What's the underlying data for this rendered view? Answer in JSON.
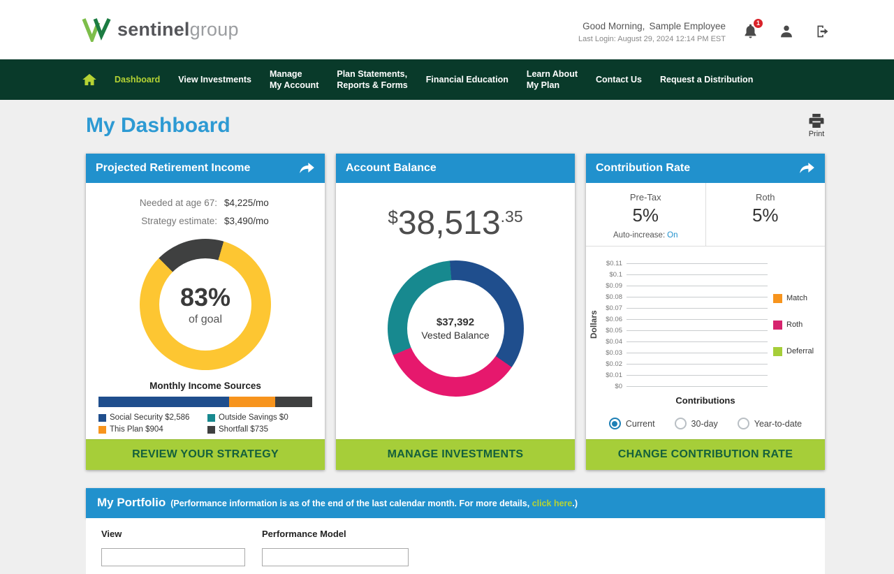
{
  "header": {
    "logo_primary": "sentinel",
    "logo_secondary": "group",
    "greeting": "Good Morning,",
    "user_name": "Sample Employee",
    "last_login": "Last Login: August 29, 2024 12:14 PM EST",
    "notification_badge": "1"
  },
  "nav": {
    "items": [
      {
        "lines": [
          "Dashboard"
        ],
        "active": true
      },
      {
        "lines": [
          "View Investments"
        ]
      },
      {
        "lines": [
          "Manage",
          "My Account"
        ]
      },
      {
        "lines": [
          "Plan Statements,",
          "Reports & Forms"
        ]
      },
      {
        "lines": [
          "Financial Education"
        ]
      },
      {
        "lines": [
          "Learn About",
          "My Plan"
        ]
      },
      {
        "lines": [
          "Contact Us"
        ]
      },
      {
        "lines": [
          "Request a Distribution"
        ]
      }
    ]
  },
  "page": {
    "title": "My Dashboard",
    "print_label": "Print"
  },
  "retirement_card": {
    "title": "Projected Retirement Income",
    "rows": [
      {
        "label": "Needed at age 67:",
        "value": "$4,225/mo"
      },
      {
        "label": "Strategy estimate:",
        "value": "$3,490/mo"
      }
    ],
    "donut_percent": "83%",
    "donut_caption": "of goal",
    "sources_title": "Monthly Income Sources",
    "legend": [
      {
        "label": "Social Security $2,586",
        "color": "#1f4e8d"
      },
      {
        "label": "Outside Savings $0",
        "color": "#17898f"
      },
      {
        "label": "This Plan $904",
        "color": "#f7941d"
      },
      {
        "label": "Shortfall $735",
        "color": "#3f4040"
      }
    ],
    "cta": "REVIEW YOUR STRATEGY"
  },
  "balance_card": {
    "title": "Account Balance",
    "currency": "$",
    "amount_whole": "38,513",
    "amount_cents": ".35",
    "donut_value": "$37,392",
    "donut_caption": "Vested Balance",
    "cta": "MANAGE INVESTMENTS"
  },
  "contribution_card": {
    "title": "Contribution Rate",
    "pretax_label": "Pre-Tax",
    "pretax_value": "5%",
    "roth_label": "Roth",
    "roth_value": "5%",
    "auto_increase_label": "Auto-increase:",
    "auto_increase_value": "On",
    "x_axis_label": "Contributions",
    "legend": [
      {
        "label": "Match",
        "color": "#f7941d"
      },
      {
        "label": "Roth",
        "color": "#d6246e"
      },
      {
        "label": "Deferral",
        "color": "#a6ce39"
      }
    ],
    "radios": [
      {
        "label": "Current",
        "selected": true
      },
      {
        "label": "30-day",
        "selected": false
      },
      {
        "label": "Year-to-date",
        "selected": false
      }
    ],
    "cta": "CHANGE CONTRIBUTION RATE"
  },
  "portfolio": {
    "title": "My Portfolio",
    "subtitle_prefix": "(Performance information is as of the end of the last calendar month. For more details, ",
    "subtitle_link": "click here",
    "subtitle_suffix": ".)",
    "view_label": "View",
    "model_label": "Performance Model"
  },
  "chart_data": [
    {
      "id": "goal_donut",
      "type": "pie",
      "title": "Projected Retirement Income - % of goal",
      "center_label": "83% of goal",
      "start_angle": 315,
      "segments": [
        {
          "label": "Shortfall",
          "pct": 17,
          "color": "#3f4040"
        },
        {
          "label": "Achieved",
          "pct": 83,
          "color": "#fdc632"
        }
      ]
    },
    {
      "id": "balance_donut",
      "type": "pie",
      "title": "Account Balance allocation",
      "center_label": "$37,392 Vested Balance",
      "start_angle": 355,
      "segments": [
        {
          "label": "navy-segment",
          "pct": 36,
          "color": "#1f4e8d"
        },
        {
          "label": "pink-segment",
          "pct": 34,
          "color": "#e6186d"
        },
        {
          "label": "teal-segment",
          "pct": 30,
          "color": "#17898f"
        }
      ]
    },
    {
      "id": "income_sources_bar",
      "type": "stacked-bar",
      "title": "Monthly Income Sources",
      "total": 4225,
      "segments": [
        {
          "label": "Social Security",
          "value": 2586,
          "color": "#1f4e8d"
        },
        {
          "label": "This Plan",
          "value": 904,
          "color": "#f7941d"
        },
        {
          "label": "Outside Savings",
          "value": 0,
          "color": "#17898f"
        },
        {
          "label": "Shortfall",
          "value": 735,
          "color": "#3f4040"
        }
      ]
    },
    {
      "id": "contribution_chart",
      "type": "bar",
      "title": "Contributions",
      "xlabel": "Contributions",
      "ylabel": "Dollars",
      "ylim": [
        0,
        0.11
      ],
      "y_ticks": [
        "$0.11",
        "$0.1",
        "$0.09",
        "$0.08",
        "$0.07",
        "$0.06",
        "$0.05",
        "$0.04",
        "$0.03",
        "$0.02",
        "$0.01",
        "$0"
      ],
      "categories": [
        "Contributions"
      ],
      "series": [
        {
          "name": "Match",
          "color": "#f7941d",
          "values": [
            0
          ]
        },
        {
          "name": "Roth",
          "color": "#d6246e",
          "values": [
            0
          ]
        },
        {
          "name": "Deferral",
          "color": "#a6ce39",
          "values": [
            0
          ]
        }
      ],
      "grid": true,
      "legend_position": "right"
    }
  ]
}
